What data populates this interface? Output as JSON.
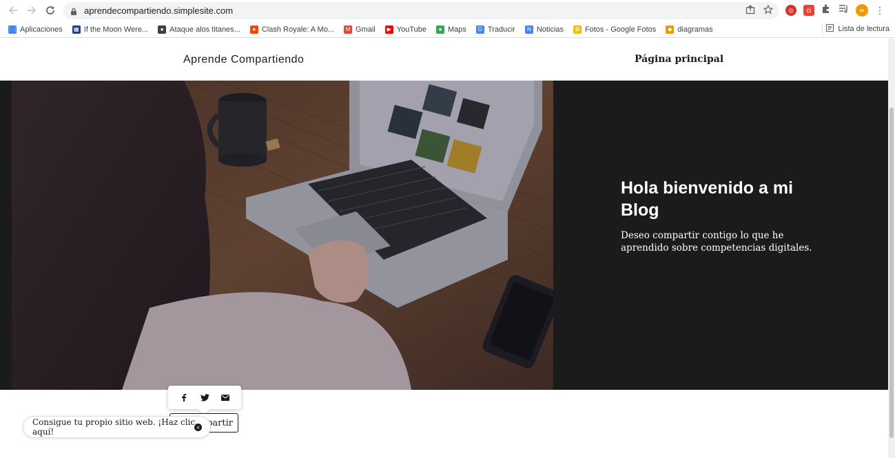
{
  "browser": {
    "url": "aprendecompartiendo.simplesite.com",
    "bookmarks": [
      {
        "label": "Aplicaciones",
        "icon": "apps-grid-icon",
        "color": "#4285f4"
      },
      {
        "label": "If the Moon Were...",
        "icon": "calendar-icon",
        "color": "#1a3f8f"
      },
      {
        "label": "Ataque alos titanes...",
        "icon": "globe-icon",
        "color": "#3c4043"
      },
      {
        "label": "Clash Royale: A Mo...",
        "icon": "reddit-icon",
        "color": "#ff4500"
      },
      {
        "label": "Gmail",
        "icon": "gmail-icon",
        "color": "#ea4335"
      },
      {
        "label": "YouTube",
        "icon": "youtube-icon",
        "color": "#ff0000"
      },
      {
        "label": "Maps",
        "icon": "maps-pin-icon",
        "color": "#34a853"
      },
      {
        "label": "Traducir",
        "icon": "translate-icon",
        "color": "#4285f4"
      },
      {
        "label": "Noticias",
        "icon": "news-icon",
        "color": "#4285f4"
      },
      {
        "label": "Fotos - Google Fotos",
        "icon": "photos-icon",
        "color": "#fbbc04"
      },
      {
        "label": "diagramas",
        "icon": "diagrams-icon",
        "color": "#f29900"
      }
    ],
    "reading_list": "Lista de lectura"
  },
  "site": {
    "title": "Aprende Compartiendo",
    "nav_item": "Página principal"
  },
  "hero": {
    "title": "Hola bienvenido a mi Blog",
    "subtitle": "Deseo compartir contigo lo que he aprendido sobre competencias digitales."
  },
  "share": {
    "button_label": "Compartir",
    "networks": [
      "facebook-icon",
      "twitter-icon",
      "email-icon"
    ]
  },
  "promo": {
    "text": "Consigue tu propio sitio web. ¡Haz clic aquí!"
  }
}
